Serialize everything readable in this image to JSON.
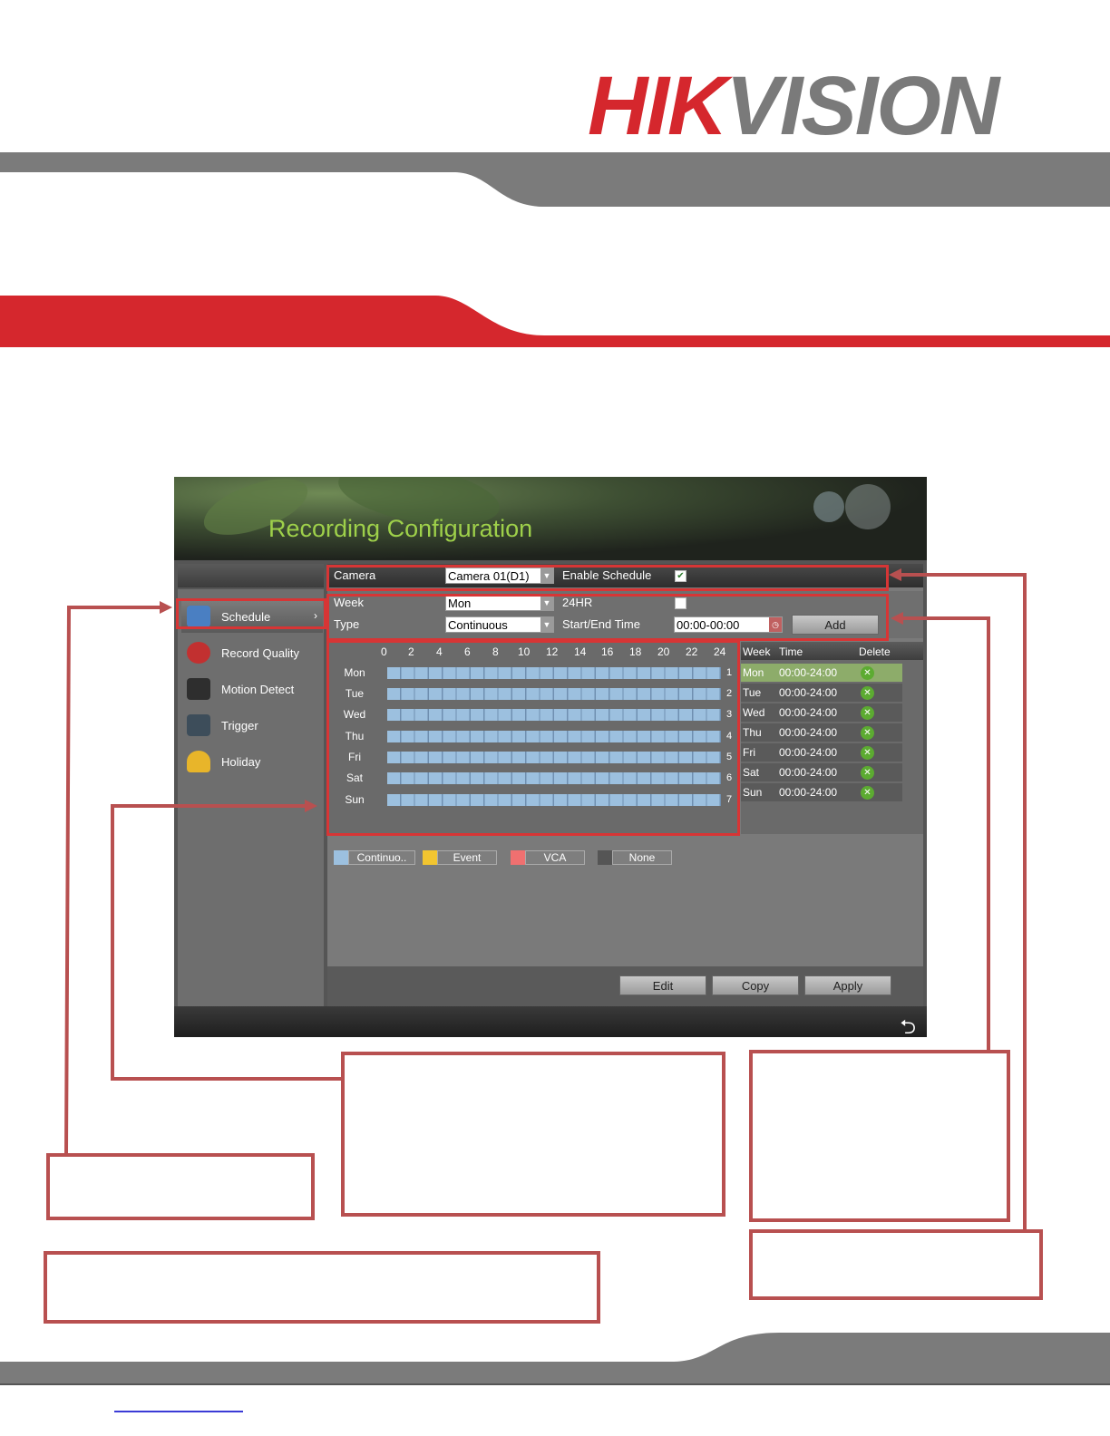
{
  "brand": {
    "logo_part1": "HIK",
    "logo_part2": "VISION",
    "red": "#d5272d",
    "grey": "#7a7a7a"
  },
  "screenshot": {
    "title": "Recording Configuration",
    "sidebar": [
      {
        "label": "Schedule",
        "icon": "calendar-icon",
        "selected": true
      },
      {
        "label": "Record Quality",
        "icon": "record-icon",
        "selected": false
      },
      {
        "label": "Motion Detect",
        "icon": "motion-icon",
        "selected": false
      },
      {
        "label": "Trigger",
        "icon": "trigger-icon",
        "selected": false
      },
      {
        "label": "Holiday",
        "icon": "umbrella-icon",
        "selected": false
      }
    ],
    "camera": {
      "label": "Camera",
      "value": "Camera 01(D1)",
      "enable_label": "Enable Schedule",
      "enable_checked": true
    },
    "week": {
      "label": "Week",
      "value": "Mon",
      "hr24_label": "24HR",
      "hr24_checked": false
    },
    "type": {
      "label": "Type",
      "value": "Continuous",
      "time_label": "Start/End Time",
      "time_value": "00:00-00:00",
      "add_label": "Add"
    },
    "hours": [
      "0",
      "2",
      "4",
      "6",
      "8",
      "10",
      "12",
      "14",
      "16",
      "18",
      "20",
      "22",
      "24"
    ],
    "days": [
      "Mon",
      "Tue",
      "Wed",
      "Thu",
      "Fri",
      "Sat",
      "Sun"
    ],
    "row_numbers": [
      "1",
      "2",
      "3",
      "4",
      "5",
      "6",
      "7"
    ],
    "list": {
      "headers": {
        "week": "Week",
        "time": "Time",
        "delete": "Delete"
      },
      "rows": [
        {
          "week": "Mon",
          "time": "00:00-24:00"
        },
        {
          "week": "Tue",
          "time": "00:00-24:00"
        },
        {
          "week": "Wed",
          "time": "00:00-24:00"
        },
        {
          "week": "Thu",
          "time": "00:00-24:00"
        },
        {
          "week": "Fri",
          "time": "00:00-24:00"
        },
        {
          "week": "Sat",
          "time": "00:00-24:00"
        },
        {
          "week": "Sun",
          "time": "00:00-24:00"
        }
      ]
    },
    "legend": [
      {
        "label": "Continuo..",
        "color": "#9cc0df"
      },
      {
        "label": "Event",
        "color": "#f2c530"
      },
      {
        "label": "VCA",
        "color": "#f07070"
      },
      {
        "label": "None",
        "color": "#555555"
      }
    ],
    "buttons": {
      "edit": "Edit",
      "copy": "Copy",
      "apply": "Apply"
    }
  }
}
